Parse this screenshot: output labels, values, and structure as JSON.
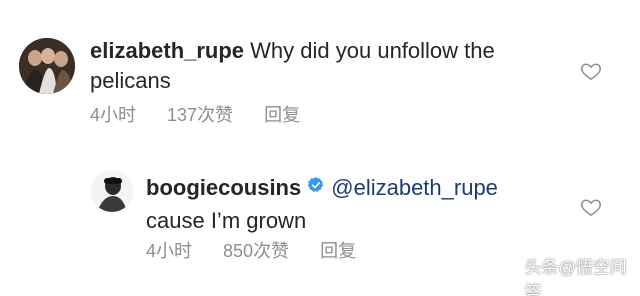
{
  "comments": [
    {
      "username": "elizabeth_rupe",
      "text": "Why did you unfollow the pelicans",
      "time": "4小时",
      "likes": "137次赞",
      "reply": "回复"
    },
    {
      "username": "boogiecousins",
      "verified": true,
      "mention": "@elizabeth_rupe",
      "text": "cause I’m grown",
      "time": "4小时",
      "likes": "850次赞",
      "reply": "回复"
    }
  ],
  "watermark": "头条@悟空问答",
  "colors": {
    "text": "#262626",
    "meta": "#8e8e8e",
    "mention": "#1c3d70",
    "verified": "#3897f0"
  }
}
